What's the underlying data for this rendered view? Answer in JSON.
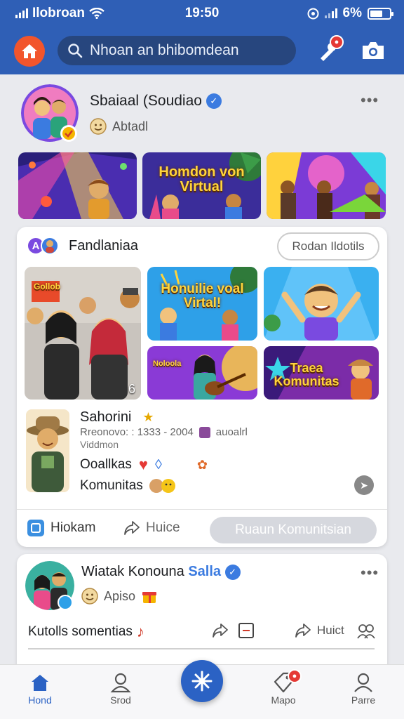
{
  "status_bar": {
    "carrier": "Ilobroan",
    "time": "19:50",
    "battery": "6%"
  },
  "header": {
    "search_placeholder": "Nhoan an bhibomdean"
  },
  "post1": {
    "name": "Sbaiaal (Soudiao",
    "name_accent": "iao",
    "subtitle": "Abtadl",
    "tile2_caption": "Homdon von Virtual"
  },
  "post2": {
    "group_name": "Fandlaniaa",
    "details_button": "Rodan Ildotils",
    "photo_count": "6",
    "tile_a_caption": "Gollob",
    "tile_b_caption": "Honuilie voal Virtal!",
    "tile_d_caption": "Noloola",
    "tile_e_caption": "Traea Komunitas",
    "member_name": "Sahorini",
    "member_meta": "Rreonovo: : 1333 - 2004",
    "member_meta_tag": "auoalrl",
    "member_meta2": "Viddmon",
    "line1": "Ooallkas",
    "line2": "Komunitas",
    "action_label": "Hiokam",
    "action_share": "Huice",
    "join_button": "Ruaun Komunitsian"
  },
  "post3": {
    "name": "Wiatak Konouna",
    "name_accent": "Salla",
    "subtitle": "Apiso",
    "caption": "Kutolls somentias",
    "share_label": "Huict"
  },
  "bottom_nav": {
    "home": "Hond",
    "search": "Srod",
    "maps": "Mapo",
    "profile": "Parre"
  },
  "colors": {
    "brand": "#2f5fb6",
    "accent_orange": "#f2552c",
    "badge_red": "#e53935"
  }
}
